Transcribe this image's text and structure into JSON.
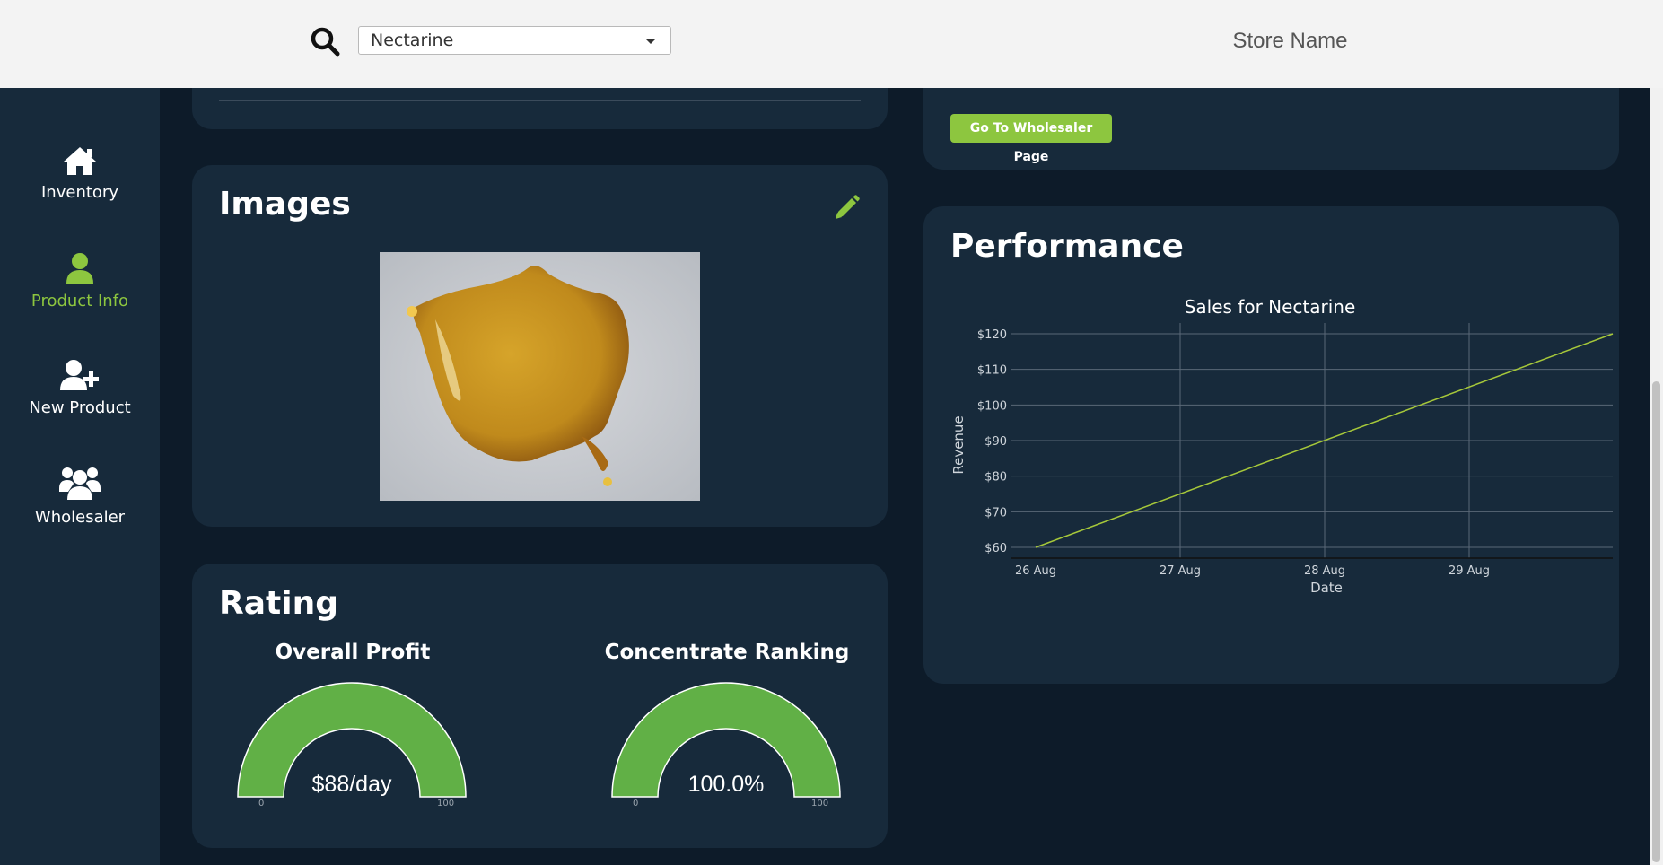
{
  "header": {
    "search_icon": "search-icon",
    "product_select": {
      "selected": "Nectarine"
    },
    "store_name": "Store Name"
  },
  "sidebar": {
    "items": [
      {
        "label": "Inventory",
        "icon": "home-icon",
        "active": false
      },
      {
        "label": "Product Info",
        "icon": "user-icon",
        "active": true
      },
      {
        "label": "New Product",
        "icon": "user-plus-icon",
        "active": false
      },
      {
        "label": "Wholesaler",
        "icon": "users-icon",
        "active": false
      }
    ],
    "accent_color": "#8dc63f"
  },
  "wholesaler": {
    "button_label": "Go To Wholesaler Page"
  },
  "images": {
    "title": "Images",
    "edit_icon": "pencil-icon"
  },
  "rating": {
    "title": "Rating",
    "gauges": [
      {
        "title": "Overall Profit",
        "value_text": "$88/day",
        "min": "0",
        "max": "100",
        "fill": 1.0
      },
      {
        "title": "Concentrate Ranking",
        "value_text": "100.0%",
        "min": "0",
        "max": "100",
        "fill": 1.0
      }
    ],
    "gauge_color": "#61b046"
  },
  "performance": {
    "title": "Performance"
  },
  "chart_data": {
    "type": "line",
    "title": "Sales for Nectarine",
    "xlabel": "Date",
    "ylabel": "Revenue",
    "x_ticks": [
      "26 Aug",
      "27 Aug",
      "28 Aug",
      "29 Aug"
    ],
    "y_ticks": [
      "$60",
      "$70",
      "$80",
      "$90",
      "$100",
      "$110",
      "$120"
    ],
    "ylim": [
      60,
      120
    ],
    "x": [
      "26 Aug 00:00",
      "30 Aug 00:00"
    ],
    "series": [
      {
        "values": [
          60,
          120
        ]
      }
    ],
    "line_color": "#a6c83a",
    "grid": true
  }
}
